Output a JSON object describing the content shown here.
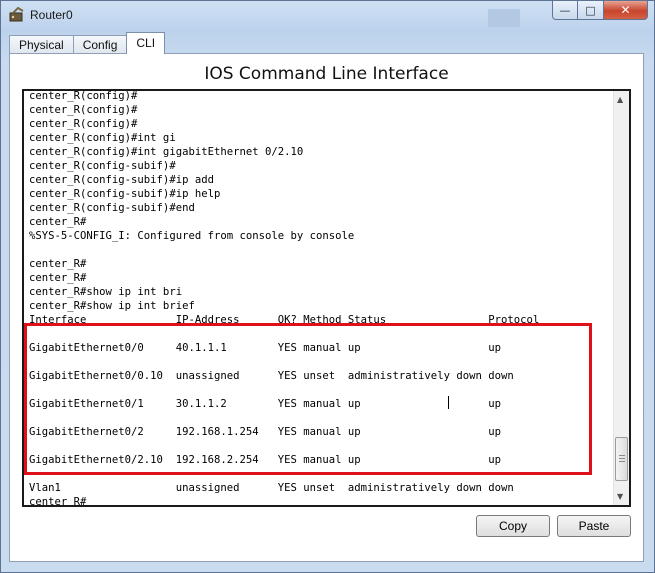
{
  "window": {
    "title": "Router0",
    "minimize_icon": "minimize-icon",
    "maximize_icon": "maximize-icon",
    "close_icon": "close-icon"
  },
  "tabs": [
    {
      "label": "Physical",
      "active": false
    },
    {
      "label": "Config",
      "active": false
    },
    {
      "label": "CLI",
      "active": true
    }
  ],
  "panel": {
    "title": "IOS Command Line Interface"
  },
  "console": {
    "lines": [
      "center_R(config)#",
      "center_R(config)#",
      "center_R(config)#",
      "center_R(config)#int gi",
      "center_R(config)#int gigabitEthernet 0/2.10",
      "center_R(config-subif)#",
      "center_R(config-subif)#ip add",
      "center_R(config-subif)#ip help",
      "center_R(config-subif)#end",
      "center_R#",
      "%SYS-5-CONFIG_I: Configured from console by console",
      "",
      "center_R#",
      "center_R#",
      "center_R#show ip int bri",
      "center_R#show ip int brief",
      "Interface              IP-Address      OK? Method Status                Protocol",
      "",
      "GigabitEthernet0/0     40.1.1.1        YES manual up                    up",
      "",
      "GigabitEthernet0/0.10  unassigned      YES unset  administratively down down",
      "",
      "GigabitEthernet0/1     30.1.1.2        YES manual up                    up",
      "",
      "GigabitEthernet0/2     192.168.1.254   YES manual up                    up",
      "",
      "GigabitEthernet0/2.10  192.168.2.254   YES manual up                    up",
      "",
      "Vlan1                  unassigned      YES unset  administratively down down",
      "center_R#"
    ],
    "highlight_color": "#e0101b"
  },
  "buttons": {
    "copy_label": "Copy",
    "paste_label": "Paste"
  },
  "colors": {
    "window_frame": "#c9dbef",
    "close_button": "#c7452c"
  }
}
